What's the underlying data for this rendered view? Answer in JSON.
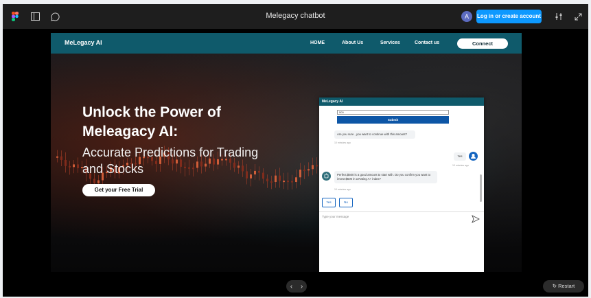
{
  "toolbar": {
    "title": "Melegacy chatbot",
    "avatar_initial": "A",
    "login_label": "Log in or create account",
    "accent": "#0d99ff"
  },
  "site": {
    "brand": "MeLegacy AI",
    "nav": [
      "HOME",
      "About Us",
      "Services",
      "Contact us"
    ],
    "connect_label": "Connect",
    "headline": "Unlock the Power of Meleagacy AI:",
    "subheadline": "Accurate Predictions for Trading and Stocks",
    "trial_label": "Get your Free Trial",
    "nav_color": "#0f5a6b"
  },
  "chat": {
    "header": "MeLegacy AI",
    "input_value": "500",
    "submit_label": "Submit",
    "bot_message_1": "Are you sure , you want to continue with this amount?",
    "ts_1": "10 minutes ago",
    "user_message": "Yes",
    "ts_2": "10 minutes ago",
    "bot_message_2": "Perfect,$500 is a good amount to start with. Do you confirm you want to invest $500 in a Rating A+ index?",
    "ts_3": "10 minutes ago",
    "option_yes": "Yes",
    "option_no": "No",
    "placeholder": "Type your message",
    "send_icon": "send-icon"
  },
  "controls": {
    "prev": "‹",
    "next": "›",
    "restart_label": "Restart"
  }
}
